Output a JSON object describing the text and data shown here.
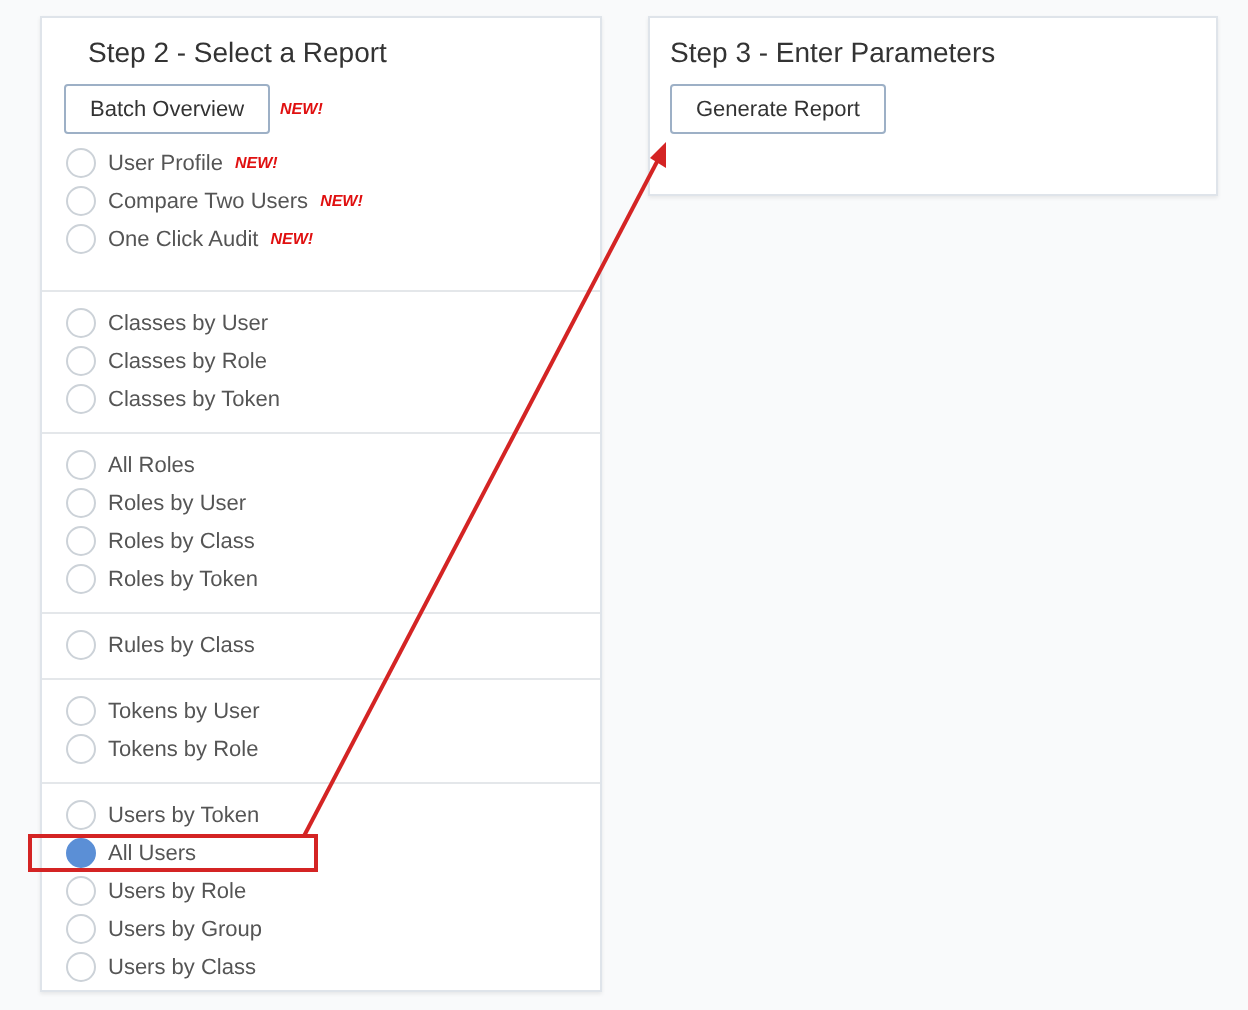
{
  "left_panel": {
    "title": "Step 2 - Select a Report",
    "batch_button": {
      "label": "Batch Overview",
      "badge": "NEW!"
    },
    "groups": [
      {
        "items": [
          {
            "label": "User Profile",
            "badge": "NEW!",
            "selected": false,
            "highlighted": false
          },
          {
            "label": "Compare Two Users",
            "badge": "NEW!",
            "selected": false,
            "highlighted": false
          },
          {
            "label": "One Click Audit",
            "badge": "NEW!",
            "selected": false,
            "highlighted": false
          }
        ]
      },
      {
        "items": [
          {
            "label": "Classes by User",
            "selected": false,
            "highlighted": false
          },
          {
            "label": "Classes by Role",
            "selected": false,
            "highlighted": false
          },
          {
            "label": "Classes by Token",
            "selected": false,
            "highlighted": false
          }
        ]
      },
      {
        "items": [
          {
            "label": "All Roles",
            "selected": false,
            "highlighted": false
          },
          {
            "label": "Roles by User",
            "selected": false,
            "highlighted": false
          },
          {
            "label": "Roles by Class",
            "selected": false,
            "highlighted": false
          },
          {
            "label": "Roles by Token",
            "selected": false,
            "highlighted": false
          }
        ]
      },
      {
        "items": [
          {
            "label": "Rules by Class",
            "selected": false,
            "highlighted": false
          }
        ]
      },
      {
        "items": [
          {
            "label": "Tokens by User",
            "selected": false,
            "highlighted": false
          },
          {
            "label": "Tokens by Role",
            "selected": false,
            "highlighted": false
          }
        ]
      },
      {
        "items": [
          {
            "label": "Users by Token",
            "selected": false,
            "highlighted": false
          },
          {
            "label": "All Users",
            "selected": true,
            "highlighted": true
          },
          {
            "label": "Users by Role",
            "selected": false,
            "highlighted": false
          },
          {
            "label": "Users by Group",
            "selected": false,
            "highlighted": false
          },
          {
            "label": "Users by Class",
            "selected": false,
            "highlighted": false
          }
        ]
      }
    ]
  },
  "right_panel": {
    "title": "Step 3 - Enter Parameters",
    "button": "Generate Report"
  }
}
